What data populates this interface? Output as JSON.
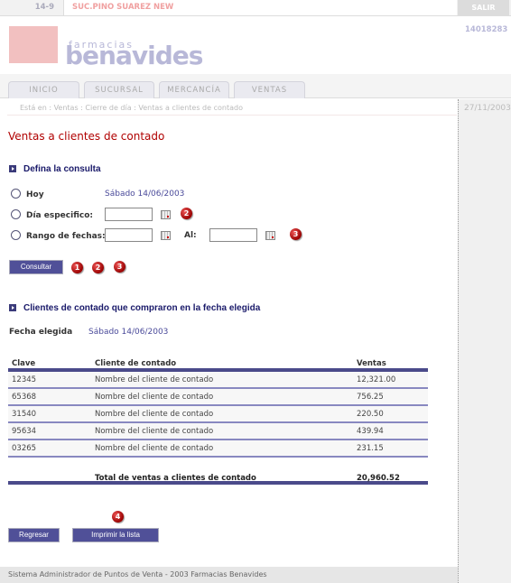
{
  "topbar": {
    "store_id": "14-9",
    "store_name": "SUC.PINO SUAREZ NEW",
    "logout": "SALIR"
  },
  "logo": {
    "small": "farmacias",
    "big": "benavides"
  },
  "header_code": "14018283",
  "tabs": [
    "INICIO",
    "SUCURSAL",
    "MERCANCÍA",
    "VENTAS"
  ],
  "breadcrumb": "Está en : Ventas : Cierre de día : Ventas a clientes de contado",
  "date": "27/11/2003",
  "page_title": "Ventas a clientes de contado",
  "query": {
    "section_title": "Defina la consulta",
    "today_label": "Hoy",
    "today_value": "Sábado 14/06/2003",
    "specific_label": "Día especifico:",
    "range_label": "Rango de fechas:",
    "to_label": "Al:",
    "submit": "Consultar",
    "badges": [
      "1",
      "2",
      "3"
    ]
  },
  "results": {
    "section_title": "Clientes de contado que compraron en la fecha elegida",
    "date_label": "Fecha elegida",
    "date_value": "Sábado 14/06/2003",
    "columns": [
      "Clave",
      "Cliente de contado",
      "Ventas"
    ],
    "rows": [
      [
        "12345",
        "Nombre del cliente de contado",
        "12,321.00"
      ],
      [
        "65368",
        "Nombre del cliente de contado",
        "756.25"
      ],
      [
        "31540",
        "Nombre del cliente de contado",
        "220.50"
      ],
      [
        "95634",
        "Nombre del cliente de contado",
        "439.94"
      ],
      [
        "03265",
        "Nombre del cliente de contado",
        "231.15"
      ]
    ],
    "total_label": "Total de ventas a clientes de contado",
    "total_value": "20,960.52"
  },
  "actions": {
    "back": "Regresar",
    "print": "Imprimir la lista",
    "badge": "4"
  },
  "footer": "Sistema Administrador de Puntos de Venta - 2003 Farmacias Benavides"
}
